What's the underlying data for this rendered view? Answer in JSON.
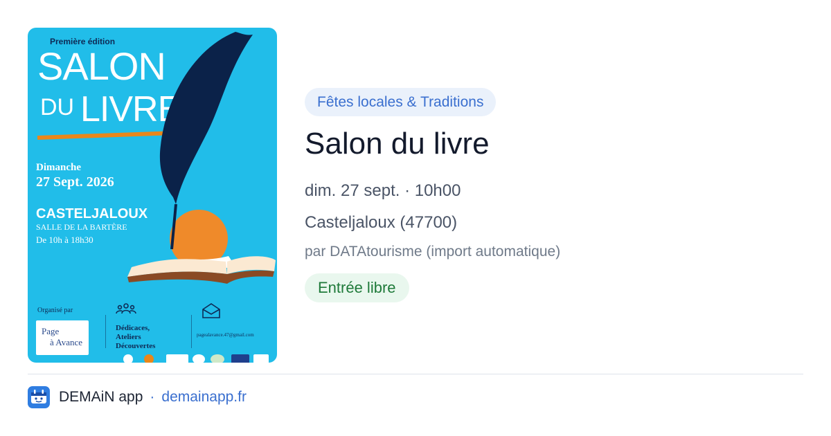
{
  "poster": {
    "edition": "Première édition",
    "title_line1": "SALON",
    "title_line2a": "DU",
    "title_line2b": "LIVRE",
    "day": "Dimanche",
    "date": "27 Sept. 2026",
    "city": "CASTELJALOUX",
    "venue": "SALLE DE LA BARTÈRE",
    "hours": "De 10h à 18h30",
    "organized_by": "Organisé par",
    "organizer_logo_line1": "Page",
    "organizer_logo_line2": "à Avance",
    "activities": "Dédicaces, Ateliers Découvertes",
    "email": "pagealavance.47@gmail.com",
    "colors": {
      "background": "#21bde9",
      "accent": "#e9871a",
      "ink": "#0e2a55"
    }
  },
  "event": {
    "category": "Fêtes locales & Traditions",
    "title": "Salon du livre",
    "datetime": "dim. 27 sept. · 10h00",
    "location": "Casteljaloux (47700)",
    "source": "par DATAtourisme (import automatique)",
    "price_badge": "Entrée libre"
  },
  "footer": {
    "app_name": "DEMAiN app",
    "separator": "·",
    "site": "demainapp.fr",
    "icon": "demain-app-logo-icon"
  },
  "colors": {
    "accent_blue": "#3a6fcf",
    "chip_bg": "#eaf1fb",
    "badge_bg": "#e9f7ee",
    "badge_text": "#1f7a3a",
    "title_text": "#131a2c"
  }
}
